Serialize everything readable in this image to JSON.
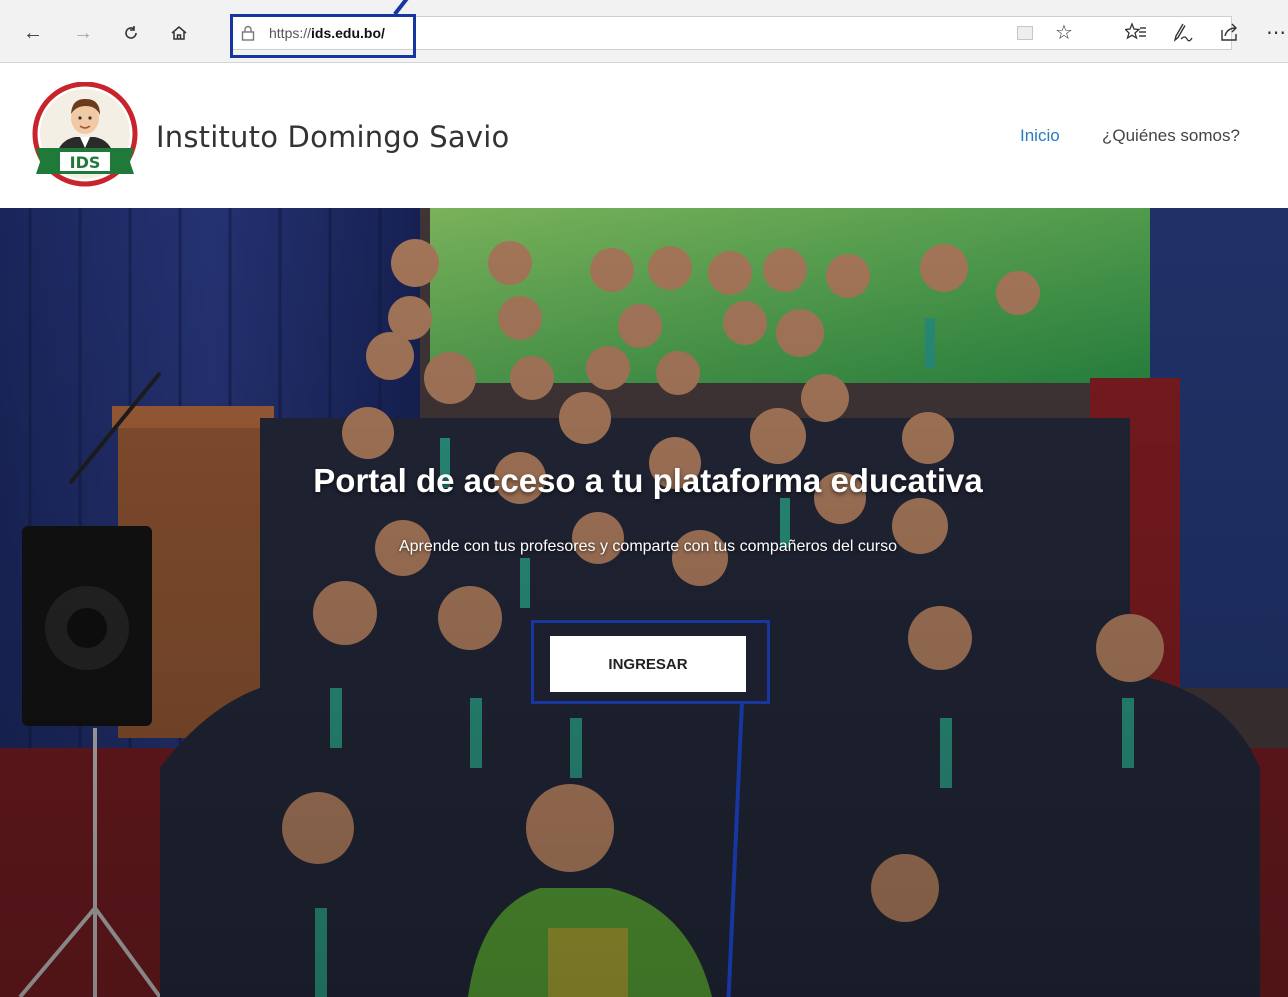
{
  "browser": {
    "url_prefix": "https://",
    "url_host": "ids.edu.bo/",
    "icons": [
      "back-arrow-icon",
      "forward-arrow-icon",
      "refresh-icon",
      "home-icon",
      "lock-icon",
      "reading-view-icon",
      "favorite-star-icon",
      "favorites-list-icon",
      "pen-notes-icon",
      "share-icon",
      "more-icon"
    ]
  },
  "site": {
    "title": "Instituto Domingo Savio",
    "logo_text": "IDS",
    "nav": [
      {
        "label": "Inicio",
        "active": true
      },
      {
        "label": "¿Quiénes somos?",
        "active": false
      }
    ]
  },
  "hero": {
    "title": "Portal de acceso a tu plataforma educativa",
    "subtitle": "Aprende con tus profesores y comparte con tus compañeros del curso",
    "cta_label": "INGRESAR"
  },
  "colors": {
    "annotation": "#1736a0",
    "nav_active": "#2a7ac0",
    "logo_green": "#1f7a3a",
    "logo_red": "#c8242b"
  }
}
